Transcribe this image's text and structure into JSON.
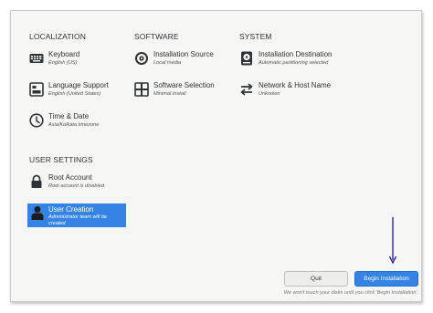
{
  "sections": {
    "localization": "LOCALIZATION",
    "software": "SOFTWARE",
    "system": "SYSTEM",
    "user_settings": "USER SETTINGS"
  },
  "spokes": {
    "keyboard": {
      "title": "Keyboard",
      "status": "English (US)",
      "icon": "keyboard-icon"
    },
    "language": {
      "title": "Language Support",
      "status": "English (United States)",
      "icon": "language-icon"
    },
    "time": {
      "title": "Time & Date",
      "status": "Asia/Kolkata timezone",
      "icon": "clock-icon"
    },
    "source": {
      "title": "Installation Source",
      "status": "Local media",
      "icon": "disc-icon"
    },
    "software": {
      "title": "Software Selection",
      "status": "Minimal Install",
      "icon": "package-icon"
    },
    "destination": {
      "title": "Installation Destination",
      "status": "Automatic partitioning selected",
      "icon": "disk-icon"
    },
    "network": {
      "title": "Network & Host Name",
      "status": "Unknown",
      "icon": "network-arrows-icon"
    },
    "root": {
      "title": "Root Account",
      "status": "Root account is disabled",
      "icon": "lock-icon"
    },
    "user": {
      "title": "User Creation",
      "status": "Administrator team will be created",
      "icon": "user-icon"
    }
  },
  "buttons": {
    "quit": "Quit",
    "begin": "Begin Installation"
  },
  "footer_note": "We won't touch your disks until you click 'Begin Installation'.",
  "colors": {
    "accent": "#3584e4",
    "annotation_arrow": "#1a1aa0"
  }
}
